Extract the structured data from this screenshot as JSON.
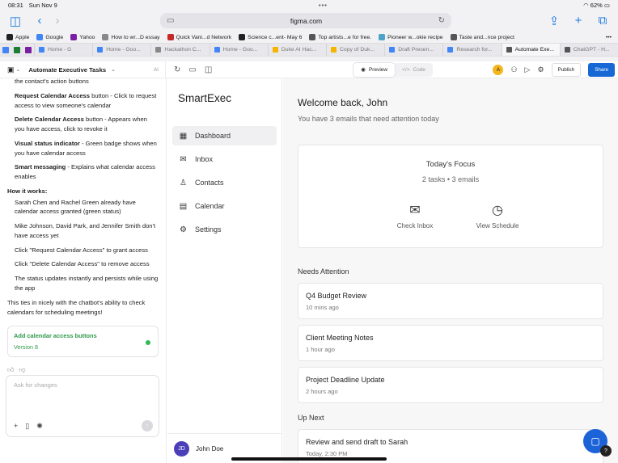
{
  "status": {
    "time": "08:31",
    "date": "Sun Nov 9",
    "battery": "62%"
  },
  "browser": {
    "url": "figma.com",
    "favorites": [
      {
        "label": "Apple",
        "color": "#222"
      },
      {
        "label": "Google",
        "color": "#4285f4"
      },
      {
        "label": "Yahoo",
        "color": "#7b1fa2"
      },
      {
        "label": "How to wr...D essay",
        "color": "#888"
      },
      {
        "label": "Quick Vani...d Network",
        "color": "#c62828"
      },
      {
        "label": "Science c...ent- May 6",
        "color": "#222"
      },
      {
        "label": "Top artists...e for free.",
        "color": "#555"
      },
      {
        "label": "Pioneer w...okie recipe",
        "color": "#4ba3c7"
      },
      {
        "label": "Taste and...nce project",
        "color": "#555"
      }
    ],
    "tabs": [
      {
        "label": "Home - G",
        "color": "#4285f4",
        "active": false
      },
      {
        "label": "Home - Goo...",
        "color": "#4285f4",
        "active": false
      },
      {
        "label": "Hackathon C...",
        "color": "#888",
        "active": false
      },
      {
        "label": "Home - Goo...",
        "color": "#4285f4",
        "active": false
      },
      {
        "label": "Duke AI Hac...",
        "color": "#f4b400",
        "active": false
      },
      {
        "label": "Copy of Duk...",
        "color": "#f4b400",
        "active": false
      },
      {
        "label": "Draft Presen...",
        "color": "#4285f4",
        "active": false
      },
      {
        "label": "Research for...",
        "color": "#4285f4",
        "active": false
      },
      {
        "label": "Automate Exe...",
        "color": "#555",
        "active": true
      },
      {
        "label": "ChatGPT - H...",
        "color": "#555",
        "active": false
      }
    ]
  },
  "appbar": {
    "project": "Automate Executive Tasks",
    "ai": "AI",
    "preview": "Preview",
    "code": "Code",
    "avatar": "A",
    "publish": "Publish",
    "share": "Share"
  },
  "chat": {
    "intro": "the contact's action buttons",
    "features": [
      {
        "bold": "Request Calendar Access",
        "text": " button - Click to request access to view someone's calendar"
      },
      {
        "bold": "Delete Calendar Access",
        "text": " button - Appears when you have access, click to revoke it"
      },
      {
        "bold": "Visual status indicator",
        "text": " - Green badge shows when you have calendar access"
      },
      {
        "bold": "Smart messaging",
        "text": " - Explains what calendar access enables"
      }
    ],
    "how_heading": "How it works:",
    "how": [
      "Sarah Chen and Rachel Green already have calendar access granted (green status)",
      "Mike Johnson, David Park, and Jennifer Smith don't have access yet",
      "Click \"Request Calendar Access\" to grant access",
      "Click \"Delete Calendar Access\" to remove access",
      "The status updates instantly and persists while using the app"
    ],
    "outro": "This ties in nicely with the chatbot's ability to check calendars for scheduling meetings!",
    "version_title": "Add calendar access buttons",
    "version_label": "Version 8",
    "input_placeholder": "Ask for changes"
  },
  "smartexec": {
    "brand": "SmartExec",
    "nav": [
      {
        "label": "Dashboard",
        "icon": "dashboard-icon",
        "glyph": "▦",
        "active": true
      },
      {
        "label": "Inbox",
        "icon": "inbox-icon",
        "glyph": "✉",
        "active": false
      },
      {
        "label": "Contacts",
        "icon": "contacts-icon",
        "glyph": "♙",
        "active": false
      },
      {
        "label": "Calendar",
        "icon": "calendar-icon",
        "glyph": "▤",
        "active": false
      },
      {
        "label": "Settings",
        "icon": "gear-icon",
        "glyph": "⚙",
        "active": false
      }
    ],
    "user": {
      "initials": "JD",
      "name": "John Doe"
    },
    "welcome": "Welcome back, John",
    "subtitle": "You have 3 emails that need attention today",
    "focus_title": "Today's Focus",
    "focus_summary": "2 tasks • 3 emails",
    "check_inbox": "Check Inbox",
    "view_schedule": "View Schedule",
    "needs_attention": "Needs Attention",
    "items": [
      {
        "title": "Q4 Budget Review",
        "time": "10 mins ago"
      },
      {
        "title": "Client Meeting Notes",
        "time": "1 hour ago"
      },
      {
        "title": "Project Deadline Update",
        "time": "2 hours ago"
      }
    ],
    "up_next": "Up Next",
    "next_item": {
      "title": "Review and send draft to Sarah",
      "time": "Today, 2:30 PM"
    }
  }
}
